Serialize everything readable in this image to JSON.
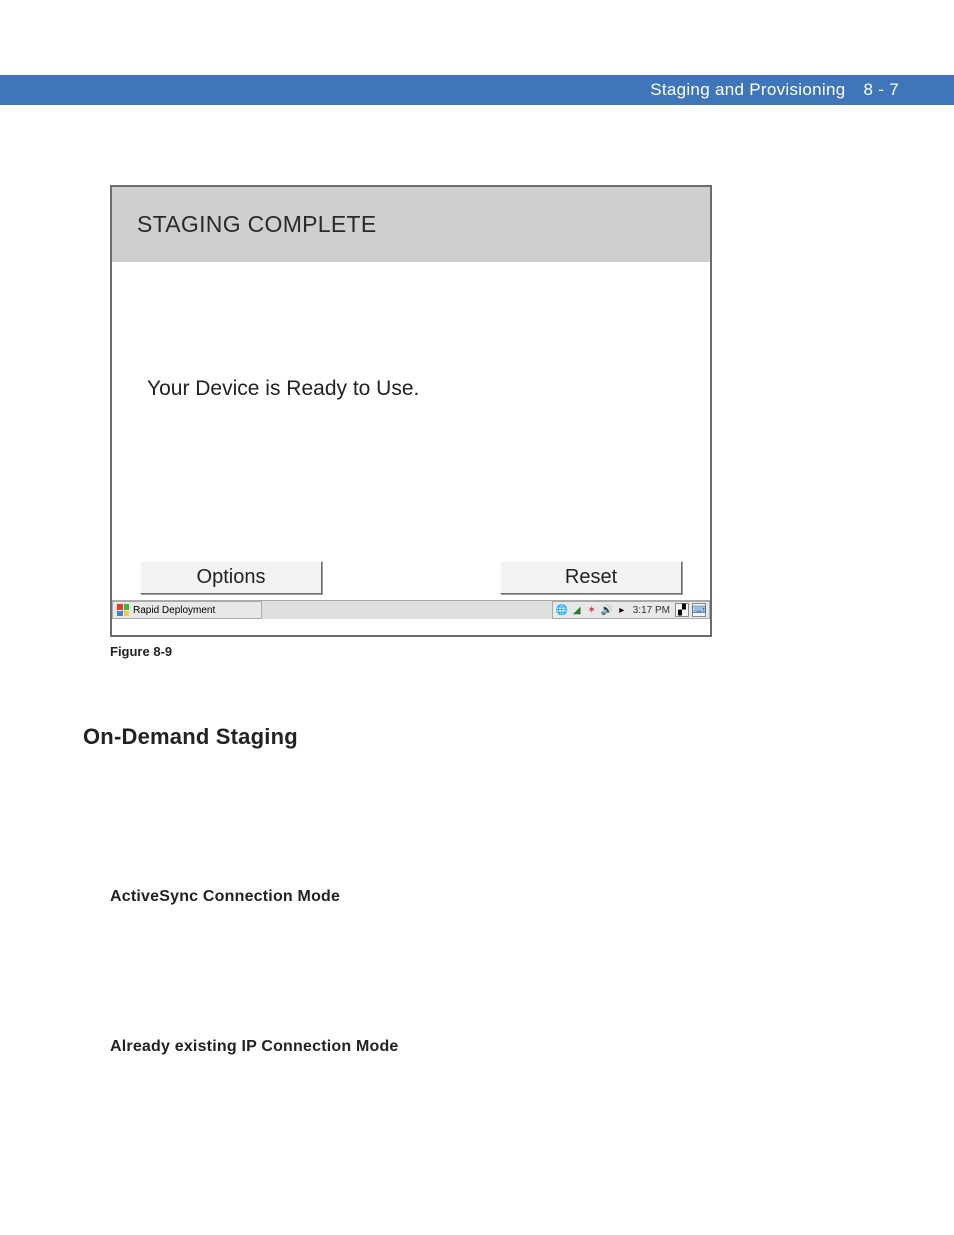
{
  "header": {
    "title": "Staging and Provisioning",
    "page": "8 - 7"
  },
  "screenshot": {
    "titlebar": "STAGING COMPLETE",
    "body_text": "Your Device is Ready to Use.",
    "options_btn": "Options",
    "reset_btn": "Reset",
    "taskbar": {
      "app": "Rapid Deployment",
      "time": "3:17 PM"
    }
  },
  "caption": "Figure 8-9",
  "sections": {
    "h1": "On-Demand Staging",
    "h2a": "ActiveSync Connection Mode",
    "h2b": "Already existing IP Connection Mode"
  }
}
